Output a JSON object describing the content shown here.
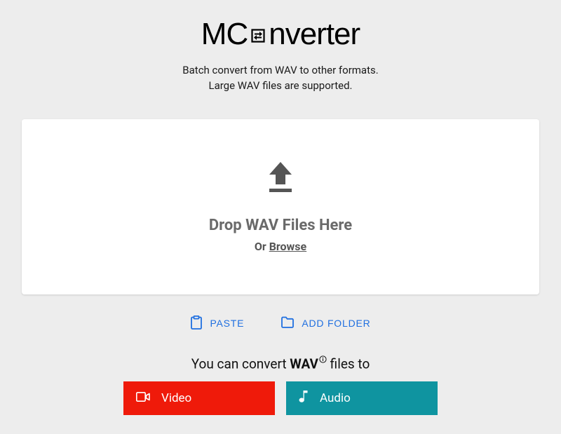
{
  "logo": {
    "part1": "MC",
    "part2": "nverter"
  },
  "subtitle": {
    "line1": "Batch convert from WAV to other formats.",
    "line2": "Large WAV files are supported."
  },
  "dropzone": {
    "title": "Drop WAV Files Here",
    "or": "Or ",
    "browse": "Browse"
  },
  "actions": {
    "paste": "PASTE",
    "add_folder": "ADD FOLDER"
  },
  "convert_line": {
    "prefix": "You can convert ",
    "format": "WAV",
    "suffix": " files to"
  },
  "format_buttons": {
    "video": "Video",
    "audio": "Audio"
  }
}
